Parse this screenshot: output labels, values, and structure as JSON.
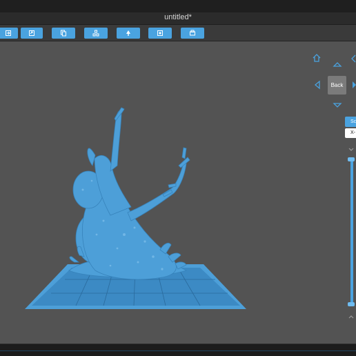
{
  "window": {
    "title": "untitled*"
  },
  "toolbar": {
    "buttons": [
      {
        "name": "import-icon"
      },
      {
        "name": "export-icon"
      },
      {
        "name": "copy-icon"
      },
      {
        "name": "layout-icon"
      },
      {
        "name": "support-icon"
      },
      {
        "name": "hollow-icon"
      },
      {
        "name": "print-icon"
      }
    ]
  },
  "view_controls": {
    "back_label": "Back",
    "mode_label": "Sc",
    "axis_label": "X-"
  },
  "colors": {
    "accent": "#4aa3e0",
    "model": "#4d9fd8",
    "viewport": "#535353"
  }
}
